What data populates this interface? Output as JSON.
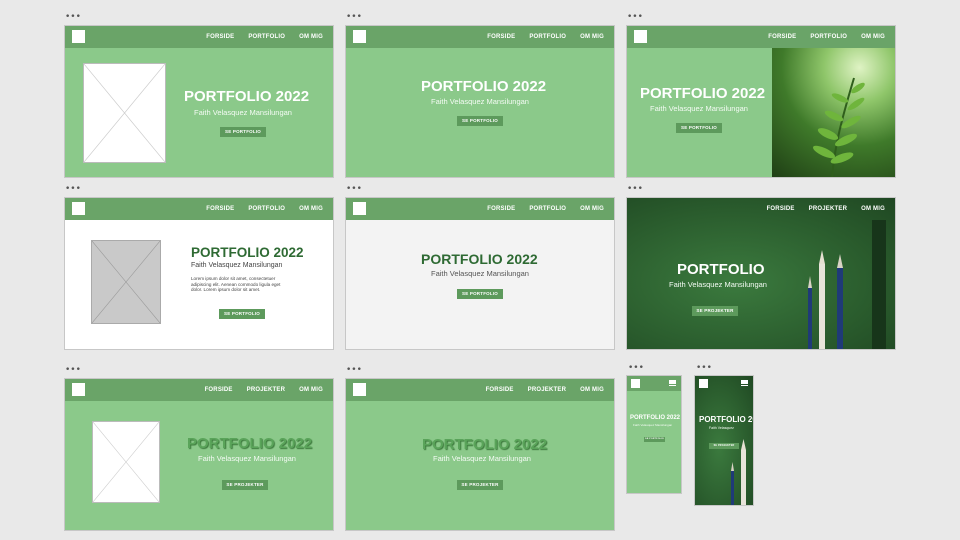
{
  "nav": {
    "home": "FORSIDE",
    "portfolio": "PORTFOLIO",
    "projects": "PROJEKTER",
    "about": "OM MIG"
  },
  "hero": {
    "title": "PORTFOLIO 2022",
    "title_short": "PORTFOLIO",
    "subtitle": "Faith Velasquez Mansilungan",
    "subtitle_short": "Faith Velasquez",
    "btn_portfolio": "SE PORTFOLIO",
    "btn_projects": "SE PROJEKTER",
    "body_text": "Lorem ipsum dolor sit amet, consectetuer adipiscing elit. Aenean commodo ligula eget dolor. Lorem ipsum dolor sit amet."
  },
  "icons": {
    "window_dots": "three-dots-icon",
    "menu": "hamburger-menu-icon",
    "placeholder": "image-placeholder-icon"
  },
  "colors": {
    "primary_green": "#8bc98a",
    "nav_green": "#6aa468",
    "dark_green": "#2f6b35",
    "button_green": "#5d9a5c"
  }
}
